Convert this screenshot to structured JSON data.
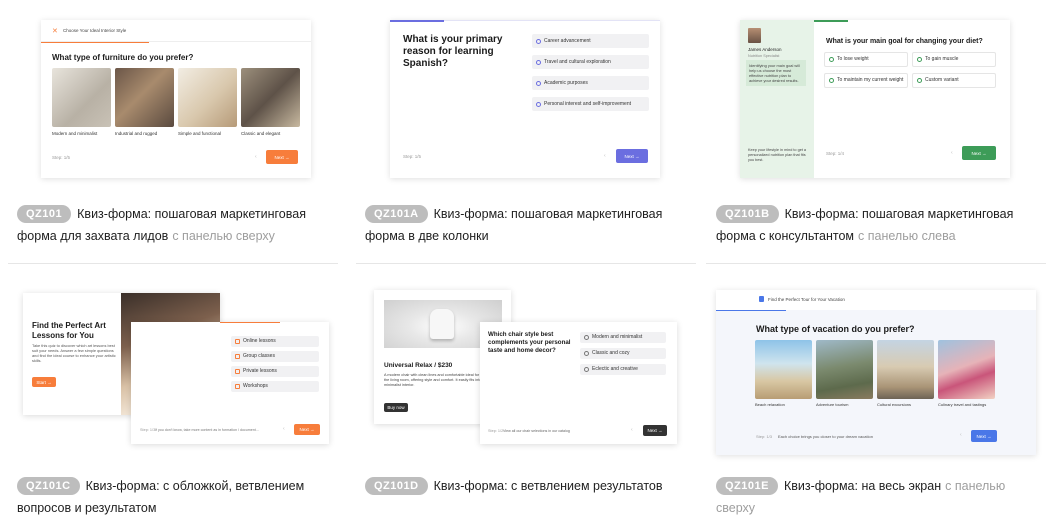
{
  "cards": [
    {
      "badge": "QZ101",
      "title": "Квиз-форма: пошаговая маркетинговая форма для захвата лидов",
      "subtitle": "с панелью сверху",
      "preview": {
        "header": "Choose Your Ideal Interior Style",
        "question": "What type of furniture do you prefer?",
        "options": [
          "Modern and minimalist",
          "Industrial and rugged",
          "Simple and functional",
          "Classic and elegant"
        ],
        "step": "Step: 1/5",
        "next": "Next →"
      }
    },
    {
      "badge": "QZ101A",
      "title": "Квиз-форма: пошаговая маркетинговая форма в две колонки",
      "subtitle": "",
      "preview": {
        "question": "What is your primary reason for learning Spanish?",
        "options": [
          "Career advancement",
          "Travel and cultural exploration",
          "Academic purposes",
          "Personal interest and self-improvement"
        ],
        "step": "Step: 1/5",
        "next": "Next →"
      }
    },
    {
      "badge": "QZ101B",
      "title": "Квиз-форма: пошаговая маркетинговая форма с консультантом",
      "subtitle": "с панелью слева",
      "preview": {
        "consultant_name": "James Anderson",
        "consultant_role": "Nutrition Specialist",
        "consultant_text": "Identifying your main goal will help us choose the most effective nutrition plan to achieve your desired results.",
        "footer_text": "Keep your lifestyle in mind to get a personalized nutrition plan that fits you best.",
        "question": "What is your main goal for changing your diet?",
        "options": [
          "To lose weight",
          "To gain muscle",
          "To maintain my current weight",
          "Custom variant"
        ],
        "step": "Step: 1/4",
        "next": "Next →"
      }
    },
    {
      "badge": "QZ101C",
      "title": "Квиз-форма: с обложкой, ветвлением вопросов и результатом",
      "subtitle": "",
      "preview": {
        "cover_title": "Find the Perfect Art Lessons for You",
        "cover_text": "Take this quiz to discover which art lessons best suit your needs. Answer a few simple questions and find the ideal course to enhance your artistic skills.",
        "cover_button": "Start →",
        "options": [
          "Online lessons",
          "Group classes",
          "Private lessons",
          "Workshops"
        ],
        "step": "Step: 1/3",
        "hint": "If you don't know, take more content as in formation / document...",
        "next": "Next →"
      }
    },
    {
      "badge": "QZ101D",
      "title": "Квиз-форма: с ветвлением результатов",
      "subtitle": "",
      "preview": {
        "result_title": "Universal Relax / $230",
        "result_text": "A modern chair with clean lines and comfortable ideal for relaxing in the living room, offering style and comfort. It easily fits into a minimalist interior.",
        "result_button": "Buy now",
        "question": "Which chair style best complements your personal taste and home decor?",
        "options": [
          "Modern and minimalist",
          "Classic and cozy",
          "Eclectic and creative"
        ],
        "step": "Step: 1/2",
        "hint": "View all our chair selections in our catalog",
        "next": "Next →"
      }
    },
    {
      "badge": "QZ101E",
      "title": "Квиз-форма: на весь экран",
      "subtitle": "с панелью сверху",
      "preview": {
        "header": "Find the Perfect Tour for Your Vacation",
        "question": "What type of vacation do you prefer?",
        "options": [
          "Beach relaxation",
          "Adventure tourism",
          "Cultural excursions",
          "Culinary travel and tastings"
        ],
        "step": "Step: 1/3",
        "hint": "Each choice brings you closer to your dream vacation",
        "next": "Next →"
      }
    }
  ],
  "colors": {
    "badge": "#bdbdbd",
    "orange": "#f77d3b",
    "purple": "#6b6ee0",
    "green": "#3d9c58",
    "blue": "#4a77e8",
    "dark": "#333333"
  }
}
